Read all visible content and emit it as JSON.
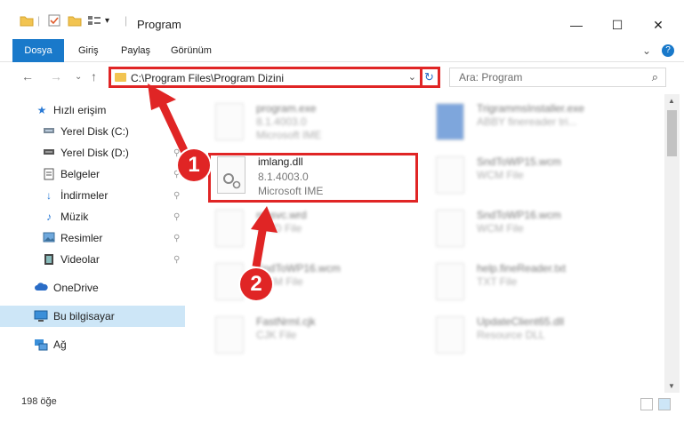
{
  "window": {
    "title": "Program",
    "minimize_glyph": "—",
    "maximize_glyph": "☐",
    "close_glyph": "✕"
  },
  "ribbon": {
    "tabs": [
      "Dosya",
      "Giriş",
      "Paylaş",
      "Görünüm"
    ],
    "help_glyph": "?",
    "expand_glyph": "⌄"
  },
  "nav": {
    "back_glyph": "←",
    "forward_glyph": "→",
    "recent_glyph": "⌄",
    "up_glyph": "↑",
    "address": "C:\\Program Files\\Program Dizini",
    "address_chevron": "⌄",
    "refresh_glyph": "↻",
    "search_placeholder": "Ara: Program",
    "search_glyph": "⌕"
  },
  "sidebar": {
    "items": [
      {
        "label": "Hızlı erişim",
        "icon": "star-icon",
        "pinned": false
      },
      {
        "label": "Yerel Disk (C:)",
        "icon": "drive-icon",
        "pinned": false
      },
      {
        "label": "Yerel Disk (D:)",
        "icon": "drive-icon",
        "pinned": true
      },
      {
        "label": "Belgeler",
        "icon": "documents-icon",
        "pinned": true
      },
      {
        "label": "İndirmeler",
        "icon": "download-icon",
        "pinned": true
      },
      {
        "label": "Müzik",
        "icon": "music-icon",
        "pinned": true
      },
      {
        "label": "Resimler",
        "icon": "pictures-icon",
        "pinned": true
      },
      {
        "label": "Videolar",
        "icon": "videos-icon",
        "pinned": true
      },
      {
        "label": "OneDrive",
        "icon": "cloud-icon",
        "pinned": false
      },
      {
        "label": "Bu bilgisayar",
        "icon": "computer-icon",
        "pinned": false
      },
      {
        "label": "Ağ",
        "icon": "network-icon",
        "pinned": false
      }
    ],
    "selected": "Bu bilgisayar",
    "pin_glyph": "📌"
  },
  "files": [
    {
      "name": "program.exe",
      "line2": "8.1.4003.0",
      "line3": "Microsoft IME",
      "blurred": true
    },
    {
      "name": "TrigrammsInstaller.exe",
      "line2": "ABBY finereader tri...",
      "line3": "",
      "blurred": true
    },
    {
      "name": "imlang.dll",
      "line2": "8.1.4003.0",
      "line3": "Microsoft IME",
      "blurred": false
    },
    {
      "name": "SndToWP15.wcm",
      "line2": "WCM File",
      "line3": "",
      "blurred": true
    },
    {
      "name": "mssvc.wrd",
      "line2": "WRD File",
      "line3": "",
      "blurred": true
    },
    {
      "name": "SndToWP16.wcm",
      "line2": "WCM File",
      "line3": "",
      "blurred": true
    },
    {
      "name": "SndToWP16.wcm",
      "line2": "WCM File",
      "line3": "",
      "blurred": true
    },
    {
      "name": "help.fineReader.txt",
      "line2": "TXT File",
      "line3": "",
      "blurred": true
    },
    {
      "name": "FastNrml.cjk",
      "line2": "CJK File",
      "line3": "",
      "blurred": true
    },
    {
      "name": "UpdateClient65.dll",
      "line2": "Resource DLL",
      "line3": "",
      "blurred": true
    }
  ],
  "status": {
    "item_count": "198 öğe"
  },
  "callouts": {
    "badge1": "1",
    "badge2": "2",
    "color": "#e02525"
  },
  "colors": {
    "accent": "#1979ca",
    "selection": "#cde6f7",
    "folder": "#f2c451"
  }
}
